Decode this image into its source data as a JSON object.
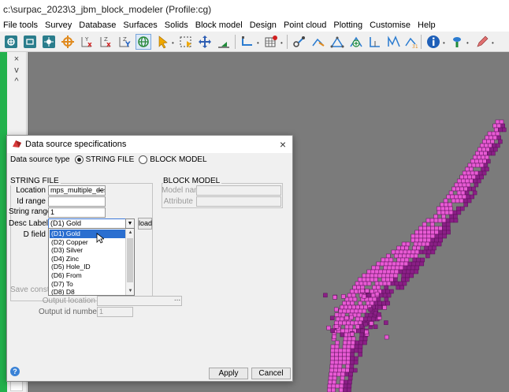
{
  "window": {
    "title": "c:\\surpac_2023\\3_jbm_block_modeler (Profile:cg)"
  },
  "menu": [
    "File tools",
    "Survey",
    "Database",
    "Surfaces",
    "Solids",
    "Block model",
    "Design",
    "Point cloud",
    "Plotting",
    "Customise",
    "Help"
  ],
  "toolbar": {
    "icons": [
      "layer-add-icon",
      "layer-remove-icon",
      "layer-view-icon",
      "crosshair-icon",
      "axis-y-x-icon",
      "axis-x-z-icon",
      "axis-z-y-icon",
      "rotate-icon",
      "select-cursor-icon",
      "box-select-icon",
      "pan-icon",
      "cross-section-icon",
      "point-select-icon",
      "grid-table-icon",
      "gear-nodes-icon",
      "string-edit-icon",
      "triangle-icon",
      "add-point-icon",
      "segment-icon",
      "multi-segment-icon",
      "info-icon",
      "property-icon",
      "pen-icon"
    ]
  },
  "left_panel": {
    "close": "×",
    "collapse": "v",
    "expand": "^"
  },
  "colors": {
    "accent": "#22b14c",
    "block": "#e85ad4",
    "block_dark": "#8a1f86",
    "viewport_bg": "#7b7b7b",
    "selection": "#2b6fd0"
  },
  "dialog": {
    "title": "Data source specifications",
    "close": "×",
    "source_type_label": "Data source type",
    "radio_string": "STRING FILE",
    "radio_block": "BLOCK MODEL",
    "string_section": "STRING FILE",
    "location_label": "Location",
    "location_value": "mps_multiple_desc",
    "browse_button": "...",
    "id_range_label": "Id range",
    "id_range_value": "",
    "string_range_label": "String range",
    "string_range_value": "1",
    "desc_labels_label": "Desc Labels",
    "desc_labels_value": "(D1) Gold",
    "load_button": "load",
    "d_field_label": "D field",
    "block_section": "BLOCK MODEL",
    "model_name_label": "Model name",
    "attribute_label": "Attribute",
    "save_constraint_label": "Save constrain",
    "output_location_label": "Output location",
    "output_id_label": "Output id number",
    "output_id_value": "1",
    "apply_button": "Apply",
    "cancel_button": "Cancel",
    "help_button": "?",
    "dropdown_items": [
      "(D1) Gold",
      "(D2) Copper",
      "(D3) Silver",
      "(D4) Zinc",
      "(D5) Hole_ID",
      "(D6) From",
      "(D7) To",
      "(D8) D8"
    ],
    "dropdown_selected": 0
  }
}
